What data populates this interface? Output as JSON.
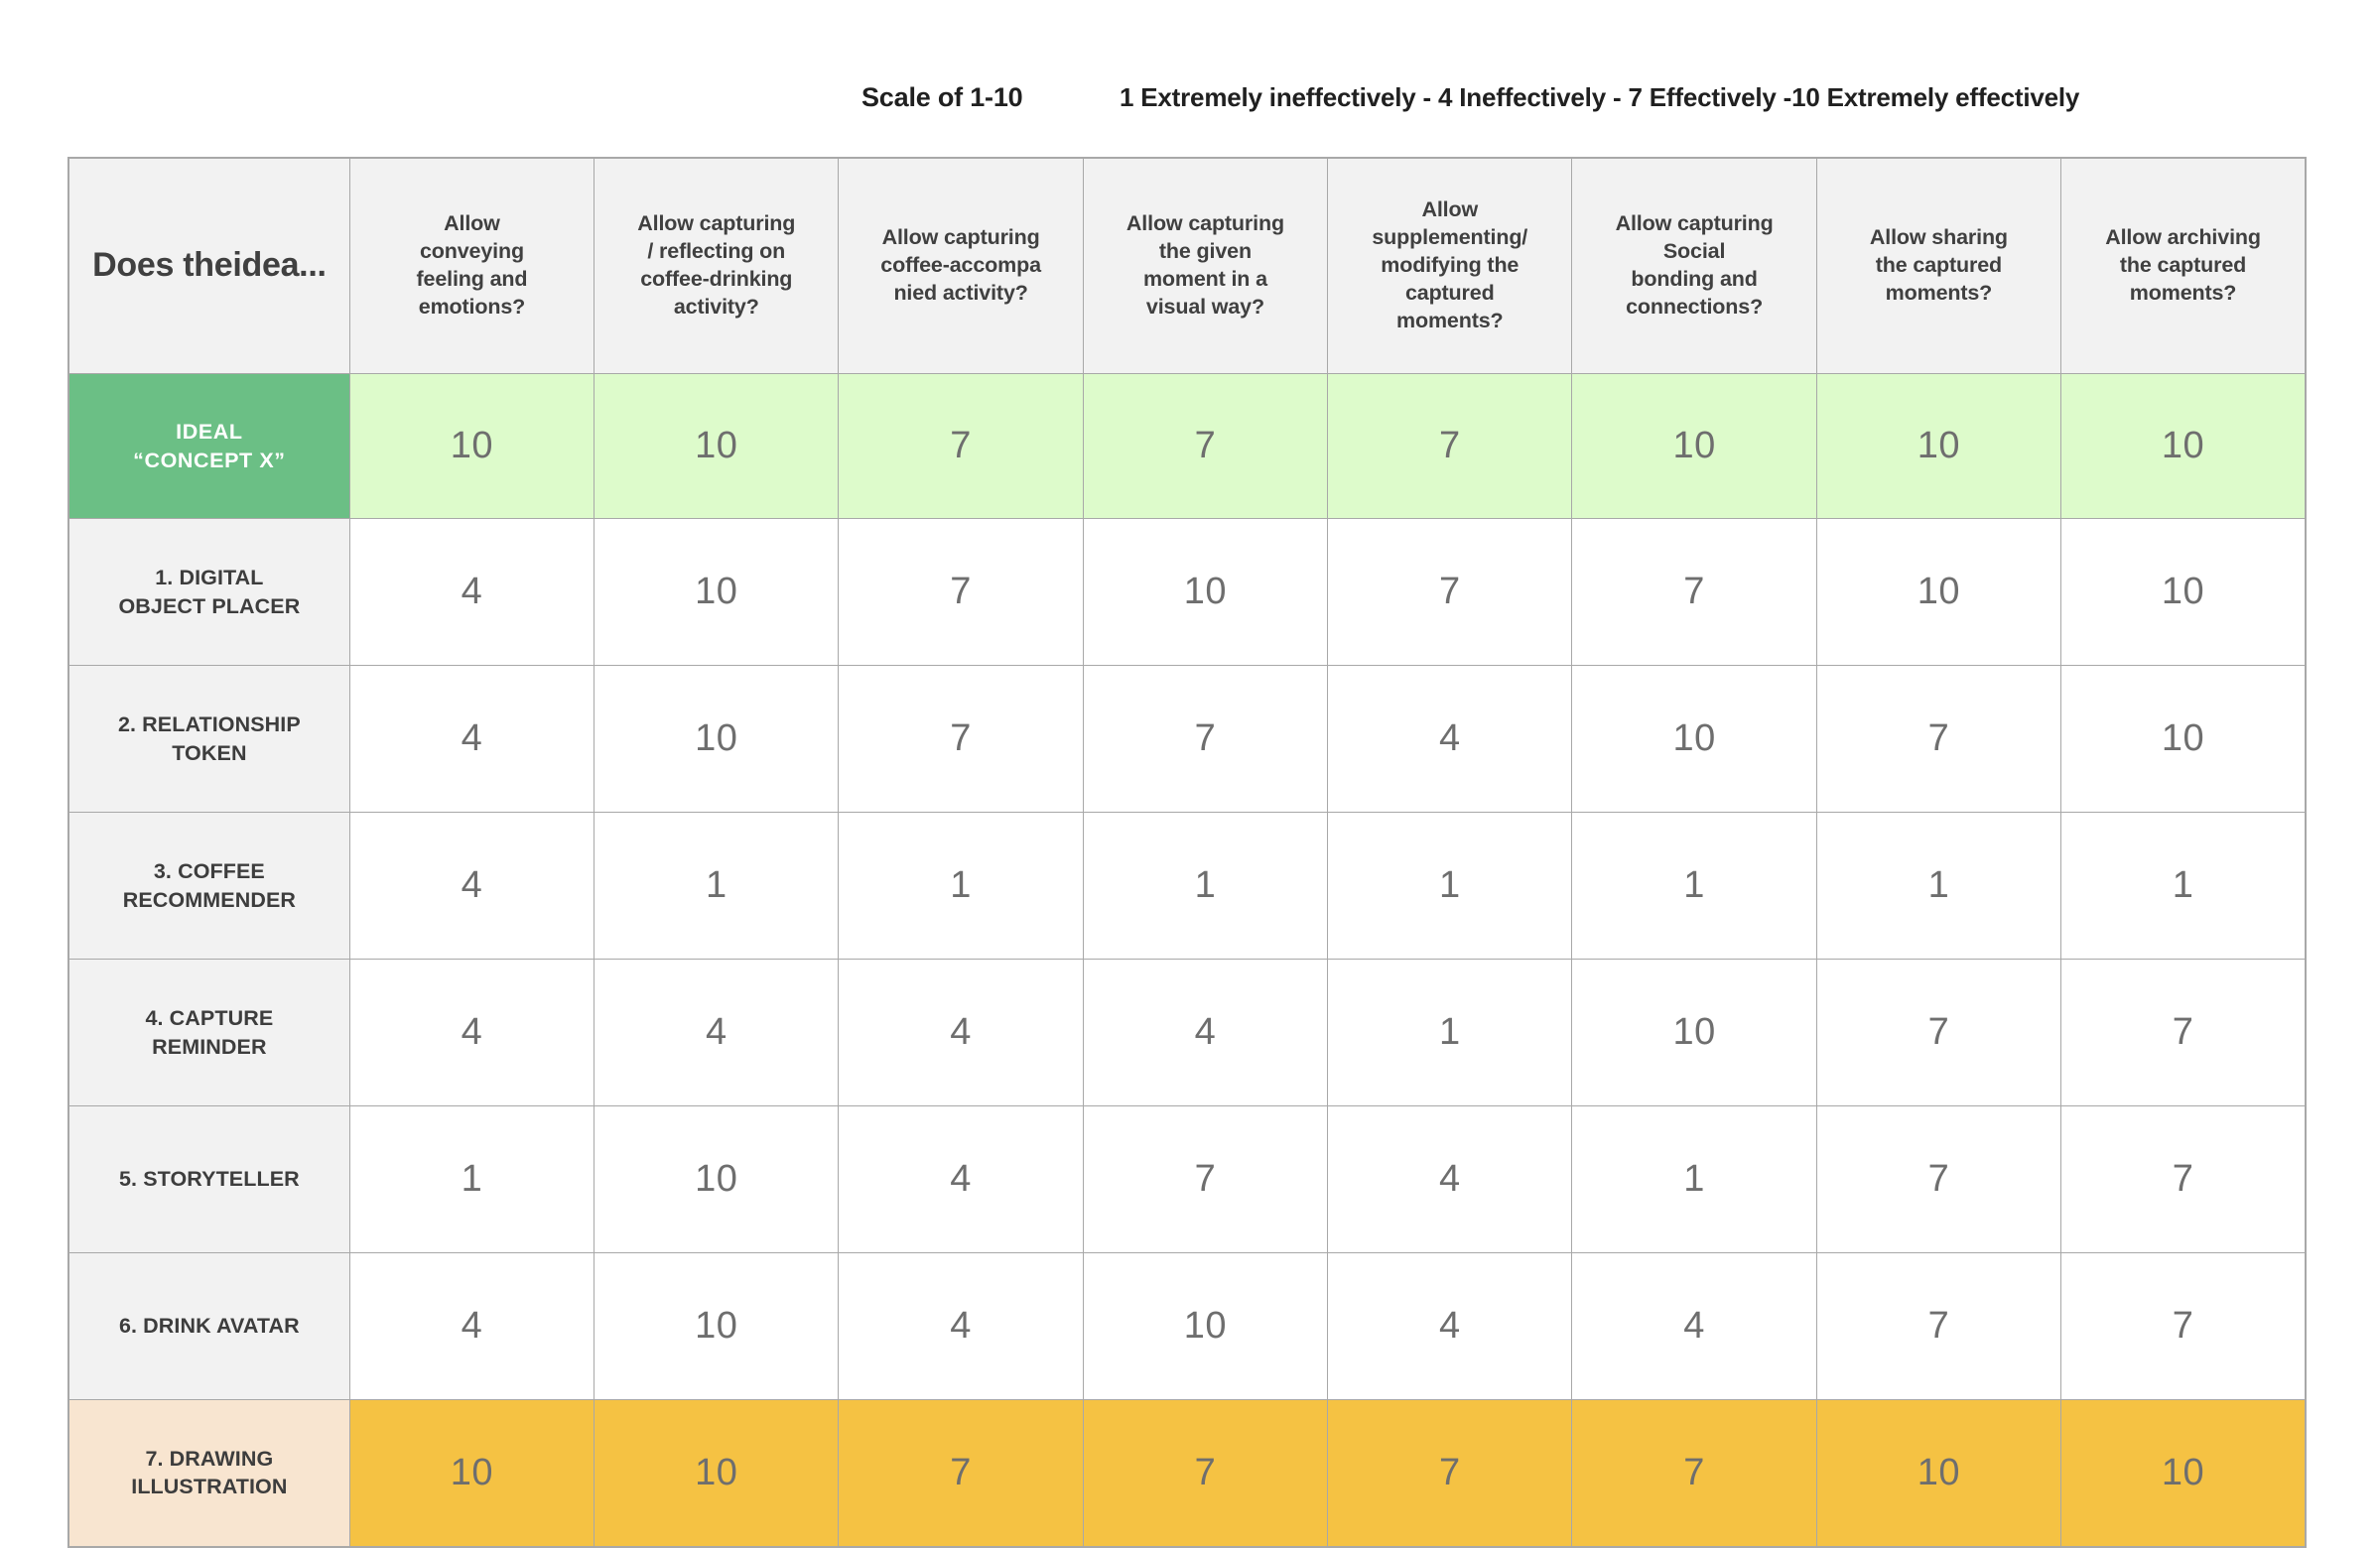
{
  "legend": {
    "scale_label": "Scale of 1-10",
    "scale_description": "1 Extremely ineffectively - 4 Ineffectively - 7 Effectively -10 Extremely effectively"
  },
  "colors": {
    "ideal_header": "#6bbf85",
    "ideal_cell": "#ddfbcb",
    "drawing_header": "#f8e5d0",
    "drawing_cell": "#f5c243",
    "header_bg": "#f2f2f2",
    "border": "#a8a8a8",
    "value_text": "#6e6e6e",
    "header_text": "#404040"
  },
  "table": {
    "corner_header": "Does the idea...",
    "corner_header_lines": [
      "Does the",
      "idea..."
    ],
    "column_headers": [
      {
        "text": "Allow conveying feeling and emotions?",
        "lines": [
          "Allow",
          "conveying",
          "feeling and",
          "emotions?"
        ]
      },
      {
        "text": "Allow capturing / reflecting on coffee-drinking activity?",
        "lines": [
          "Allow capturing",
          "/ reflecting on",
          "coffee-drinking",
          "activity?"
        ]
      },
      {
        "text": "Allow capturing coffee-accompanied activity?",
        "lines": [
          "Allow capturing",
          "coffee-accompa",
          "nied activity?"
        ]
      },
      {
        "text": "Allow capturing the given moment in a visual way?",
        "lines": [
          "Allow capturing",
          "the given",
          "moment in a",
          "visual way?"
        ]
      },
      {
        "text": "Allow supplementing/ modifying the captured moments?",
        "lines": [
          "Allow",
          "supplementing/",
          "modifying the",
          "captured",
          "moments?"
        ]
      },
      {
        "text": "Allow capturing Social bonding and connections?",
        "lines": [
          "Allow capturing",
          "Social",
          "bonding and",
          "connections?"
        ]
      },
      {
        "text": "Allow sharing the captured moments?",
        "lines": [
          "Allow sharing",
          "the captured",
          "moments?"
        ]
      },
      {
        "text": "Allow archiving the captured moments?",
        "lines": [
          "Allow archiving",
          "the captured",
          "moments?"
        ]
      }
    ],
    "rows": [
      {
        "label": "IDEAL “CONCEPT X”",
        "label_lines": [
          "IDEAL",
          "“CONCEPT X”"
        ],
        "style": "ideal",
        "values": [
          10,
          10,
          7,
          7,
          7,
          10,
          10,
          10
        ]
      },
      {
        "label": "1. DIGITAL OBJECT PLACER",
        "label_lines": [
          "1. DIGITAL",
          "OBJECT PLACER"
        ],
        "style": "normal",
        "values": [
          4,
          10,
          7,
          10,
          7,
          7,
          10,
          10
        ]
      },
      {
        "label": "2. RELATIONSHIP TOKEN",
        "label_lines": [
          "2. RELATIONSHIP",
          "TOKEN"
        ],
        "style": "normal",
        "values": [
          4,
          10,
          7,
          7,
          4,
          10,
          7,
          10
        ]
      },
      {
        "label": "3. COFFEE RECOMMENDER",
        "label_lines": [
          "3. COFFEE",
          "RECOMMENDER"
        ],
        "style": "normal",
        "values": [
          4,
          1,
          1,
          1,
          1,
          1,
          1,
          1
        ]
      },
      {
        "label": "4. CAPTURE REMINDER",
        "label_lines": [
          "4. CAPTURE",
          "REMINDER"
        ],
        "style": "normal",
        "values": [
          4,
          4,
          4,
          4,
          1,
          10,
          7,
          7
        ]
      },
      {
        "label": "5. STORYTELLER",
        "label_lines": [
          "5. STORYTELLER"
        ],
        "style": "normal",
        "values": [
          1,
          10,
          4,
          7,
          4,
          1,
          7,
          7
        ]
      },
      {
        "label": "6. DRINK AVATAR",
        "label_lines": [
          "6. DRINK AVATAR"
        ],
        "style": "normal",
        "values": [
          4,
          10,
          4,
          10,
          4,
          4,
          7,
          7
        ]
      },
      {
        "label": "7. DRAWING ILLUSTRATION",
        "label_lines": [
          "7. DRAWING",
          "ILLUSTRATION"
        ],
        "style": "drawing",
        "values": [
          10,
          10,
          7,
          7,
          7,
          7,
          10,
          10
        ]
      }
    ]
  },
  "chart_data": {
    "type": "table",
    "title": "Does the idea...",
    "categories": [
      "Allow conveying feeling and emotions?",
      "Allow capturing / reflecting on coffee-drinking activity?",
      "Allow capturing coffee-accompanied activity?",
      "Allow capturing the given moment in a visual way?",
      "Allow supplementing/ modifying the captured moments?",
      "Allow capturing Social bonding and connections?",
      "Allow sharing the captured moments?",
      "Allow archiving the captured moments?"
    ],
    "series": [
      {
        "name": "IDEAL “CONCEPT X”",
        "values": [
          10,
          10,
          7,
          7,
          7,
          10,
          10,
          10
        ]
      },
      {
        "name": "1. DIGITAL OBJECT PLACER",
        "values": [
          4,
          10,
          7,
          10,
          7,
          7,
          10,
          10
        ]
      },
      {
        "name": "2. RELATIONSHIP TOKEN",
        "values": [
          4,
          10,
          7,
          7,
          4,
          10,
          7,
          10
        ]
      },
      {
        "name": "3. COFFEE RECOMMENDER",
        "values": [
          4,
          1,
          1,
          1,
          1,
          1,
          1,
          1
        ]
      },
      {
        "name": "4. CAPTURE REMINDER",
        "values": [
          4,
          4,
          4,
          4,
          1,
          10,
          7,
          7
        ]
      },
      {
        "name": "5. STORYTELLER",
        "values": [
          1,
          10,
          4,
          7,
          4,
          1,
          7,
          7
        ]
      },
      {
        "name": "6. DRINK AVATAR",
        "values": [
          4,
          10,
          4,
          10,
          4,
          4,
          7,
          7
        ]
      },
      {
        "name": "7. DRAWING ILLUSTRATION",
        "values": [
          10,
          10,
          7,
          7,
          7,
          7,
          10,
          10
        ]
      }
    ],
    "scale": {
      "min": 1,
      "max": 10,
      "levels": [
        1,
        4,
        7,
        10
      ],
      "level_labels": [
        "Extremely ineffectively",
        "Ineffectively",
        "Effectively",
        "Extremely effectively"
      ]
    },
    "xlabel": "",
    "ylabel": "",
    "grid": true,
    "legend": "none"
  }
}
